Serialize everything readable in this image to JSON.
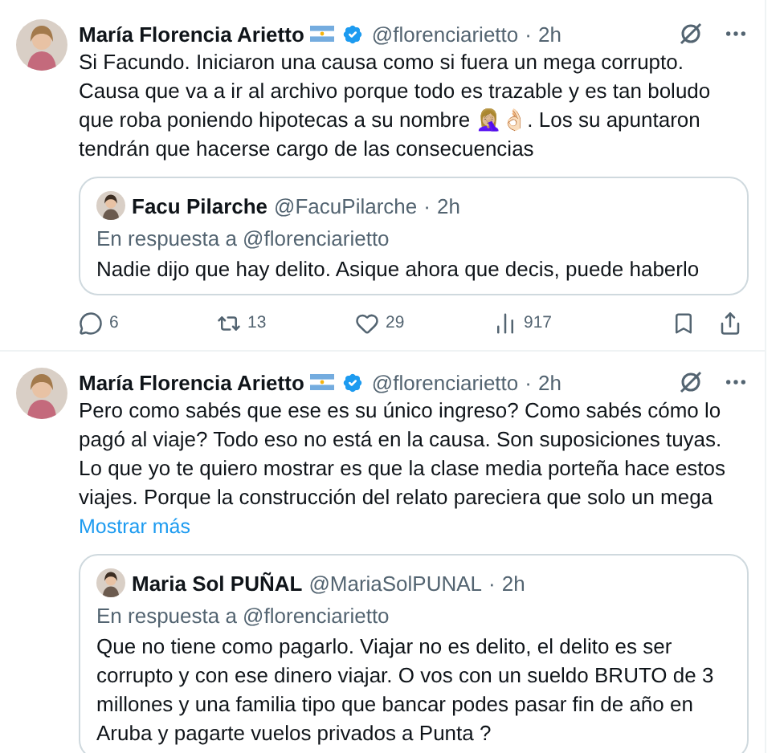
{
  "tweets": [
    {
      "author": "María Florencia Arietto",
      "handle": "@florenciarietto",
      "sep": "·",
      "time": "2h",
      "verified": true,
      "text": "Si Facundo. Iniciaron una causa como si fuera un mega corrupto. Causa que va a ir al archivo porque todo es trazable y es tan boludo que roba poniendo hipotecas a su nombre 🤦🏼‍♀️👌🏻. Los su apuntaron tendrán que hacerse cargo de las consecuencias",
      "quote": {
        "author": "Facu Pilarche",
        "handle": "@FacuPilarche",
        "sep": "·",
        "time": "2h",
        "reply_to": "En respuesta a @florenciarietto",
        "text": "Nadie dijo que hay delito. Asique ahora que decis, puede haberlo"
      },
      "metrics": [
        {
          "kind": "reply",
          "count": "6"
        },
        {
          "kind": "repost",
          "count": "13"
        },
        {
          "kind": "like",
          "count": "29"
        },
        {
          "kind": "views",
          "count": "917"
        }
      ]
    },
    {
      "author": "María Florencia Arietto",
      "handle": "@florenciarietto",
      "sep": "·",
      "time": "2h",
      "verified": true,
      "text": "Pero como sabés que ese es su único ingreso? Como sabés cómo lo pagó al viaje? Todo eso no está en la causa. Son suposiciones tuyas. Lo que yo te quiero mostrar es que la clase media porteña hace estos viajes. Porque la construcción del relato pareciera que solo un mega",
      "show_more": "Mostrar más",
      "quote": {
        "author": "Maria Sol PUÑAL",
        "handle": "@MariaSolPUNAL",
        "sep": "·",
        "time": "2h",
        "reply_to": "En respuesta a @florenciarietto",
        "text": "Que no tiene como pagarlo. Viajar no es delito, el delito es ser corrupto y con ese dinero viajar. O vos con un sueldo BRUTO de 3 millones y una familia tipo que bancar podes pasar fin de año en Aruba y pagarte vuelos privados a Punta ?"
      }
    }
  ]
}
